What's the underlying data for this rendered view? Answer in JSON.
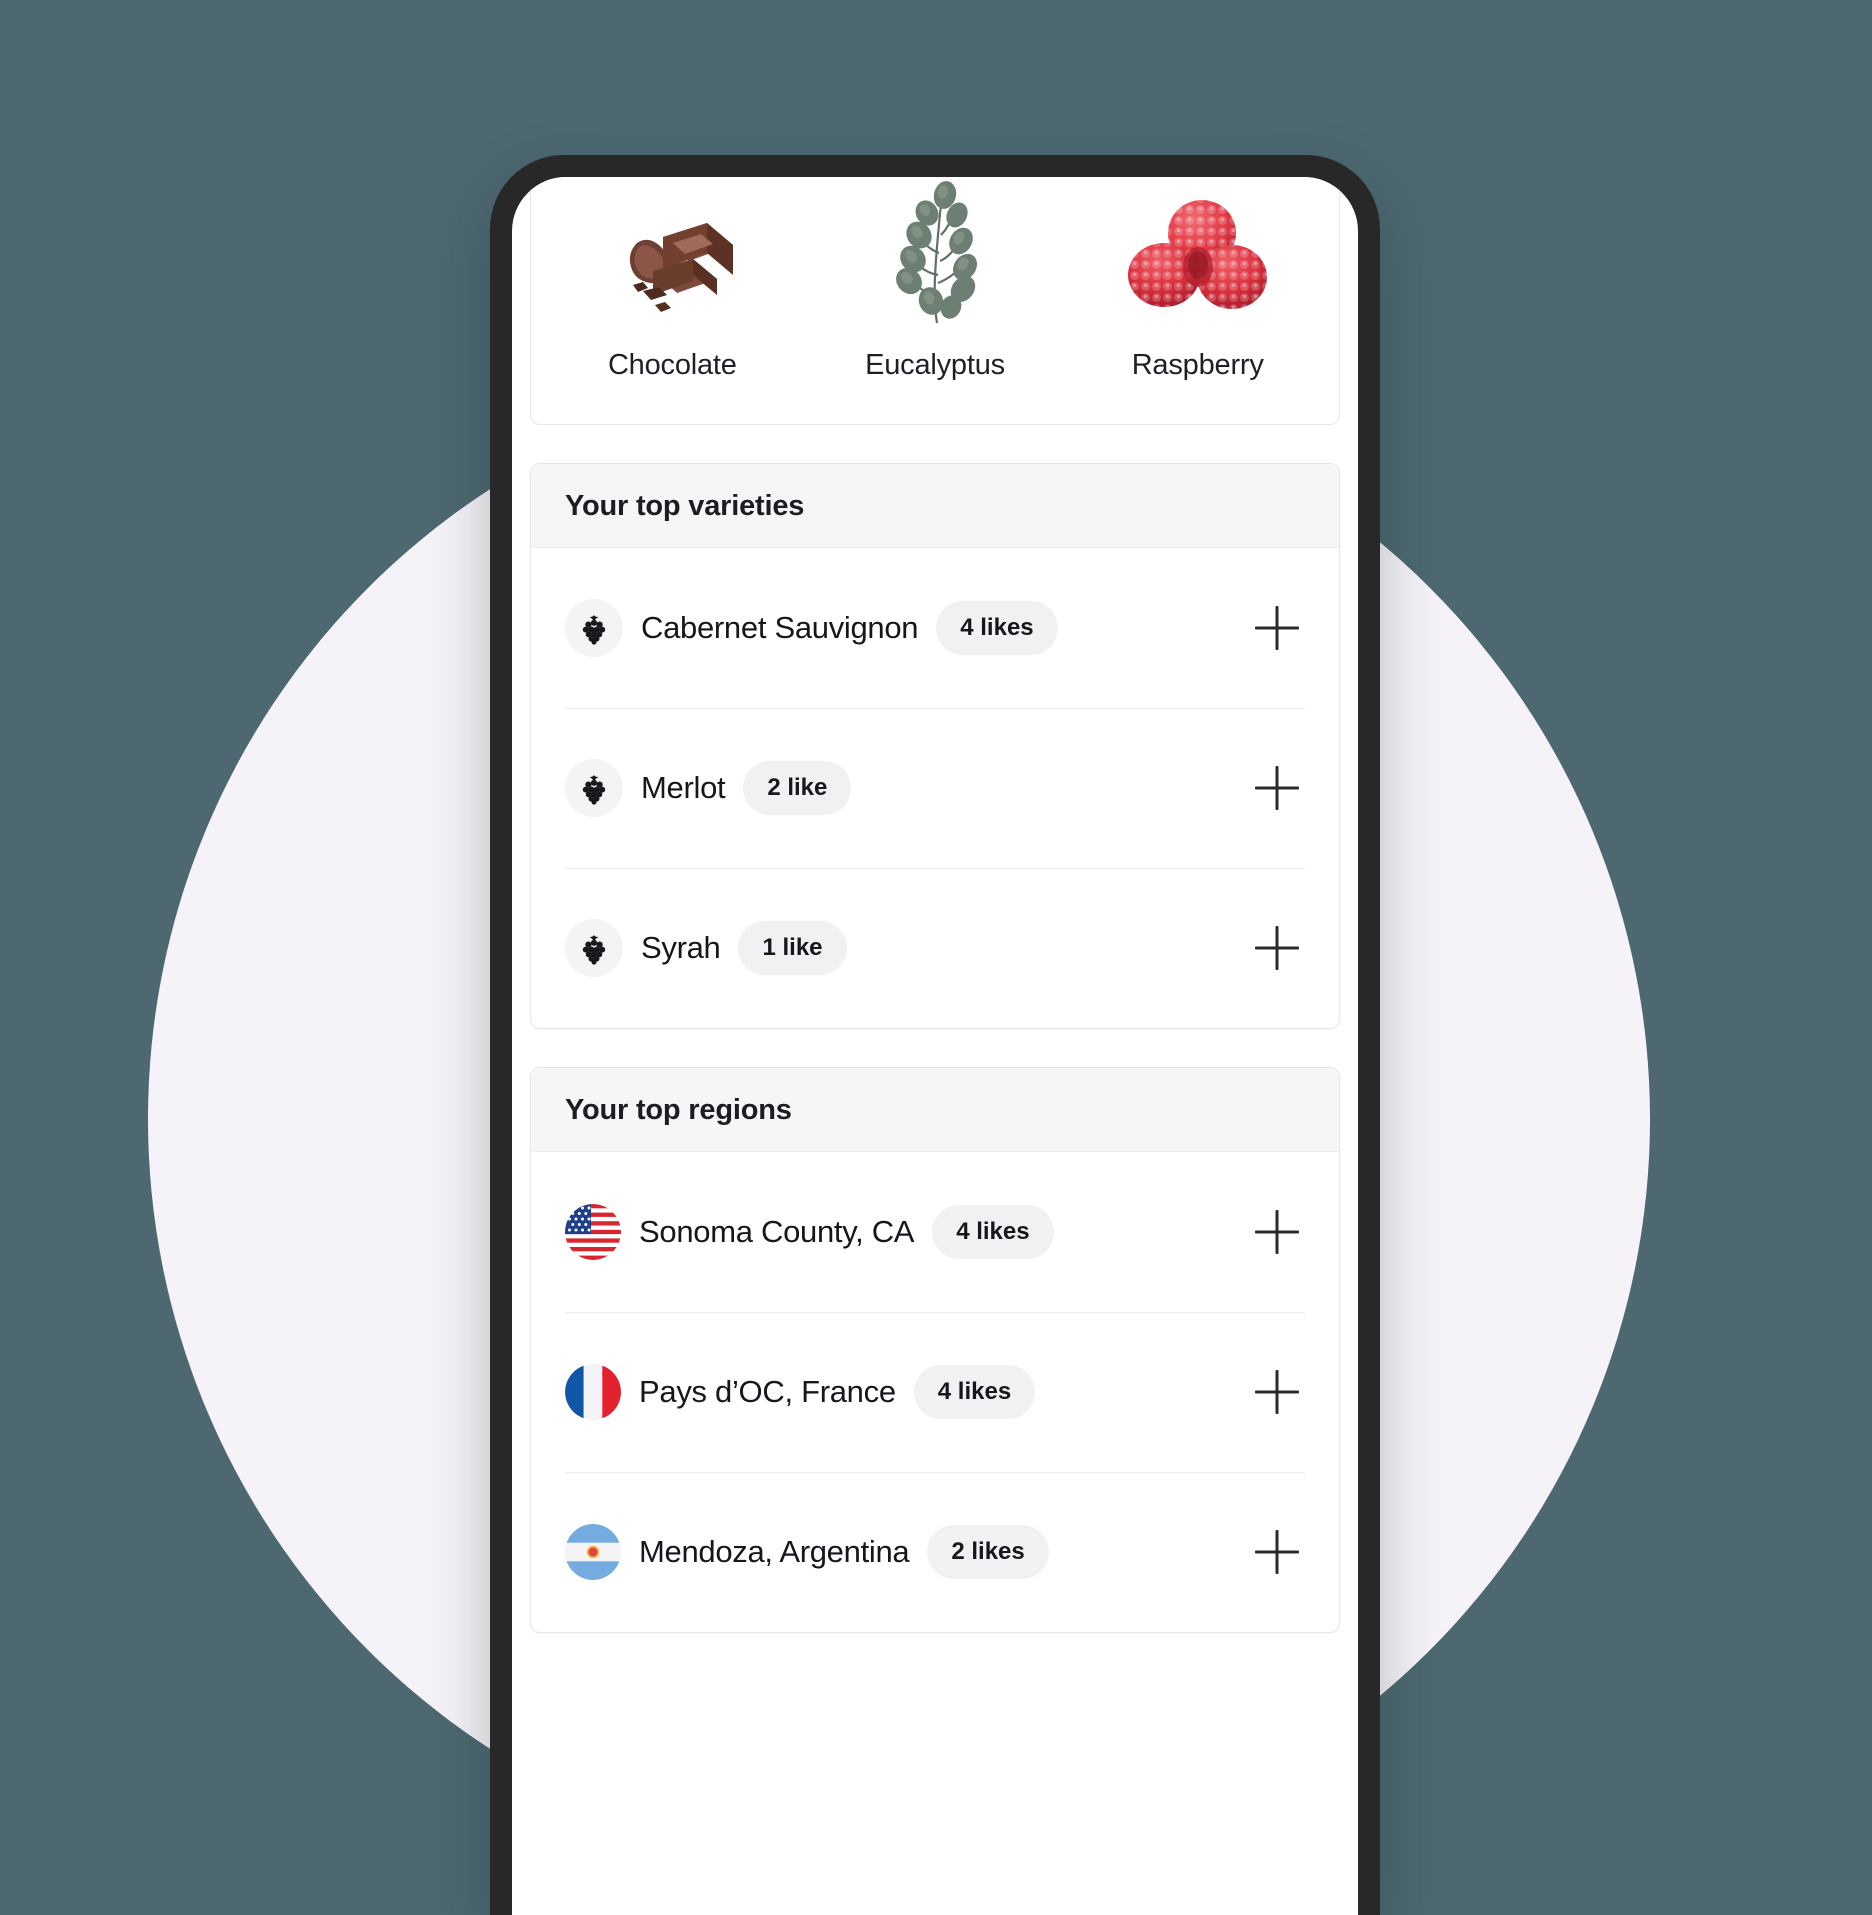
{
  "background": {
    "page_color": "#4D6871",
    "circle_color": "#F5F3F7",
    "device_frame_color": "#282828"
  },
  "flavors_card": {
    "items": [
      {
        "label": "Chocolate",
        "icon": "chocolate-icon"
      },
      {
        "label": "Eucalyptus",
        "icon": "eucalyptus-icon"
      },
      {
        "label": "Raspberry",
        "icon": "raspberry-icon"
      }
    ]
  },
  "varieties_card": {
    "title": "Your top varieties",
    "rows": [
      {
        "icon": "grape-icon",
        "label": "Cabernet Sauvignon",
        "badge": "4 likes",
        "action": "add-icon"
      },
      {
        "icon": "grape-icon",
        "label": "Merlot",
        "badge": "2 like",
        "action": "add-icon"
      },
      {
        "icon": "grape-icon",
        "label": "Syrah",
        "badge": "1 like",
        "action": "add-icon"
      }
    ]
  },
  "regions_card": {
    "title": "Your top regions",
    "rows": [
      {
        "icon": "flag-usa-icon",
        "label": "Sonoma County, CA",
        "badge": "4 likes",
        "action": "add-icon"
      },
      {
        "icon": "flag-france-icon",
        "label": "Pays d’OC, France",
        "badge": "4 likes",
        "action": "add-icon"
      },
      {
        "icon": "flag-argentina-icon",
        "label": "Mendoza, Argentina",
        "badge": "2 likes",
        "action": "add-icon"
      }
    ]
  }
}
